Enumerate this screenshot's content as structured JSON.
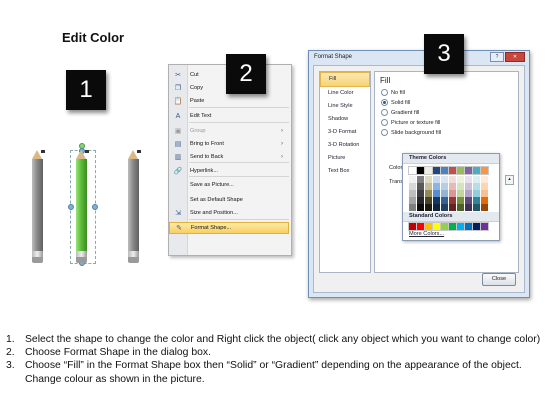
{
  "title": "Edit Color",
  "badges": [
    "1",
    "2",
    "3"
  ],
  "context_menu": {
    "items": [
      {
        "icon": "scissors-icon",
        "glyph": "✂",
        "label": "Cut",
        "disabled": false,
        "submenu": false
      },
      {
        "icon": "copy-icon",
        "glyph": "❐",
        "label": "Copy",
        "disabled": false,
        "submenu": false
      },
      {
        "icon": "paste-icon",
        "glyph": "📋",
        "label": "Paste",
        "disabled": false,
        "submenu": false
      },
      {
        "icon": "edit-text-icon",
        "glyph": "A",
        "label": "Edit Text",
        "disabled": false,
        "submenu": false
      },
      {
        "icon": "group-icon",
        "glyph": "▣",
        "label": "Group",
        "disabled": true,
        "submenu": true
      },
      {
        "icon": "bring-front-icon",
        "glyph": "▤",
        "label": "Bring to Front",
        "disabled": false,
        "submenu": true
      },
      {
        "icon": "send-back-icon",
        "glyph": "▥",
        "label": "Send to Back",
        "disabled": false,
        "submenu": true
      },
      {
        "icon": "hyperlink-icon",
        "glyph": "🔗",
        "label": "Hyperlink...",
        "disabled": false,
        "submenu": false
      },
      {
        "icon": "",
        "glyph": "",
        "label": "Save as Picture...",
        "disabled": false,
        "submenu": false
      },
      {
        "icon": "",
        "glyph": "",
        "label": "Set as Default Shape",
        "disabled": false,
        "submenu": false
      },
      {
        "icon": "size-position-icon",
        "glyph": "⇲",
        "label": "Size and Position...",
        "disabled": false,
        "submenu": false
      },
      {
        "icon": "format-shape-icon",
        "glyph": "✎",
        "label": "Format Shape...",
        "disabled": false,
        "submenu": false,
        "highlighted": true
      }
    ]
  },
  "dialog": {
    "title": "Format Shape",
    "title_buttons": [
      "?",
      "✕"
    ],
    "nav": [
      "Fill",
      "Line Color",
      "Line Style",
      "Shadow",
      "3-D Format",
      "3-D Rotation",
      "Picture",
      "Text Box"
    ],
    "nav_selected": "Fill",
    "section_heading": "Fill",
    "options": [
      "No fill",
      "Solid fill",
      "Gradient fill",
      "Picture or texture fill",
      "Slide background fill"
    ],
    "selected_option": "Solid fill",
    "color_label": "Color:",
    "transparency_label": "Transpa",
    "palette": {
      "theme_heading": "Theme Colors",
      "theme_top": [
        "#ffffff",
        "#000000",
        "#eeece1",
        "#1f497d",
        "#4f81bd",
        "#c0504d",
        "#9bbb59",
        "#8064a2",
        "#4bacc6",
        "#f79646"
      ],
      "theme_rows": [
        [
          "#f2f2f2",
          "#7f7f7f",
          "#ddd9c3",
          "#c6d9f0",
          "#dbe5f1",
          "#f2dcdb",
          "#ebf1dd",
          "#e5e0ec",
          "#dbeef3",
          "#fdeada"
        ],
        [
          "#d8d8d8",
          "#595959",
          "#c4bd97",
          "#8db3e2",
          "#b8cce4",
          "#e5b9b7",
          "#d7e3bc",
          "#ccc1d9",
          "#b7dde8",
          "#fbd5b5"
        ],
        [
          "#bfbfbf",
          "#3f3f3f",
          "#938953",
          "#548dd4",
          "#95b3d7",
          "#d99694",
          "#c3d69b",
          "#b2a2c7",
          "#92cddc",
          "#fac08f"
        ],
        [
          "#a5a5a5",
          "#262626",
          "#494429",
          "#17365d",
          "#366092",
          "#953734",
          "#76923c",
          "#5f497a",
          "#31859b",
          "#e36c09"
        ],
        [
          "#7f7f7f",
          "#0c0c0c",
          "#1d1b10",
          "#0f243e",
          "#244061",
          "#632423",
          "#4f6128",
          "#3f3151",
          "#205867",
          "#974806"
        ]
      ],
      "standard_heading": "Standard Colors",
      "standard": [
        "#c00000",
        "#ff0000",
        "#ffc000",
        "#ffff00",
        "#92d050",
        "#00b050",
        "#00b0f0",
        "#0070c0",
        "#002060",
        "#7030a0"
      ],
      "more_label": "More Colors..."
    },
    "close_label": "Close"
  },
  "pencils": {
    "colors": [
      "#8a8a8a",
      "#5cbd3a",
      "#8a8a8a"
    ]
  },
  "steps": [
    {
      "num": "1.",
      "text": "Select the shape to change the color and Right click the object( click any object which you want to change color)"
    },
    {
      "num": "2.",
      "text": "Choose Format Shape in the dialog box."
    },
    {
      "num": "3.",
      "text": "Choose “Fill” in the Format Shape box then “Solid” or “Gradient” depending on the appearance of the object. Change colour as shown in the picture."
    }
  ]
}
